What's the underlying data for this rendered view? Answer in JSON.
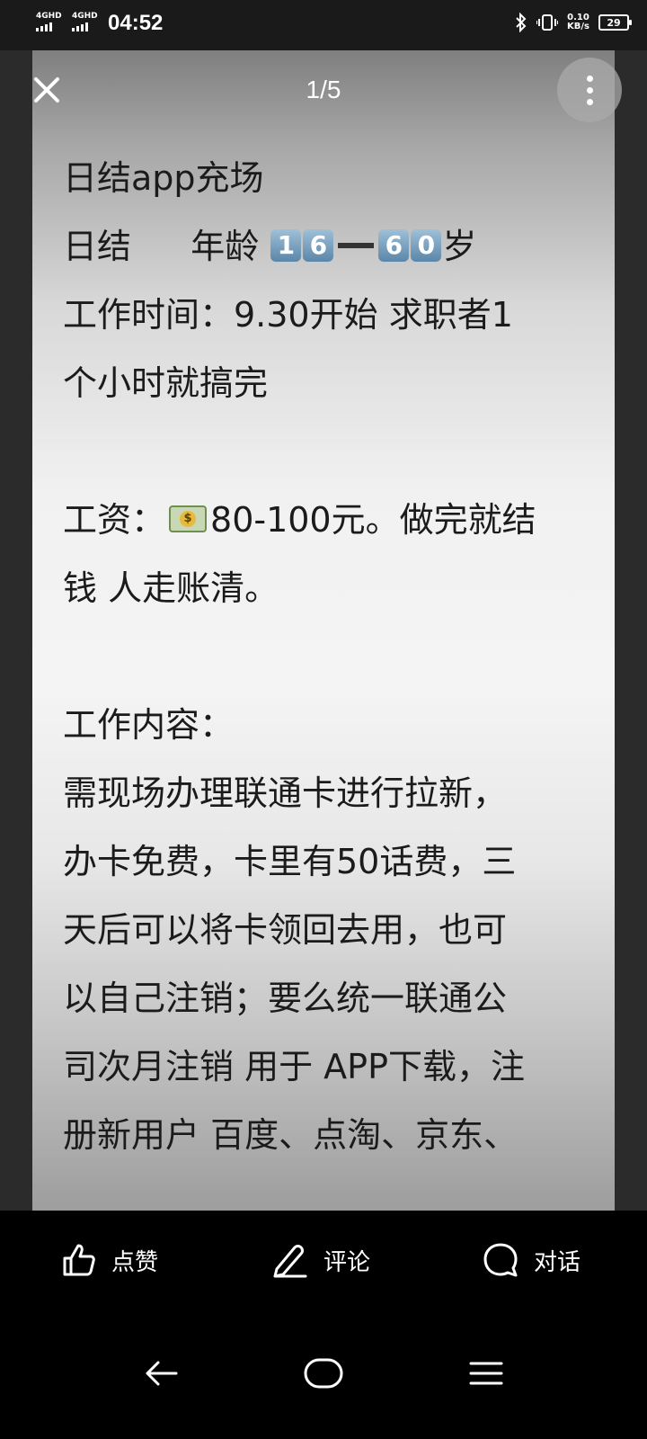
{
  "status_bar": {
    "network1": "4GHD",
    "network2": "4GHD",
    "time": "04:52",
    "speed_value": "0.10",
    "speed_unit": "KB/s",
    "battery": "29"
  },
  "viewer": {
    "counter": "1/5",
    "lines": [
      "日结app充场",
      "日结",
      "年龄",
      "岁",
      "工作时间：9.30开始 求职者1",
      "个小时就搞完",
      "工资：",
      "80-100元。做完就结",
      "钱 人走账清。",
      "工作内容：",
      "需现场办理联通卡进行拉新，",
      "办卡免费，卡里有50话费，三",
      "天后可以将卡领回去用，也可",
      "以自己注销；要么统一联通公",
      "司次月注销 用于 APP下载，注",
      "册新用户 百度、点淘、京东、"
    ],
    "age_digits": [
      "1",
      "6",
      "6",
      "0"
    ]
  },
  "actions": {
    "like": "点赞",
    "comment": "评论",
    "chat": "对话"
  },
  "icons": {
    "close": "close-icon",
    "more": "more-vertical-icon",
    "like": "thumbs-up-icon",
    "comment": "pencil-icon",
    "chat": "chat-bubble-icon",
    "back": "back-arrow-icon",
    "home": "home-pill-icon",
    "menu": "menu-icon",
    "bluetooth": "bluetooth-icon",
    "vibrate": "vibrate-icon",
    "money": "money-banknote-emoji"
  }
}
